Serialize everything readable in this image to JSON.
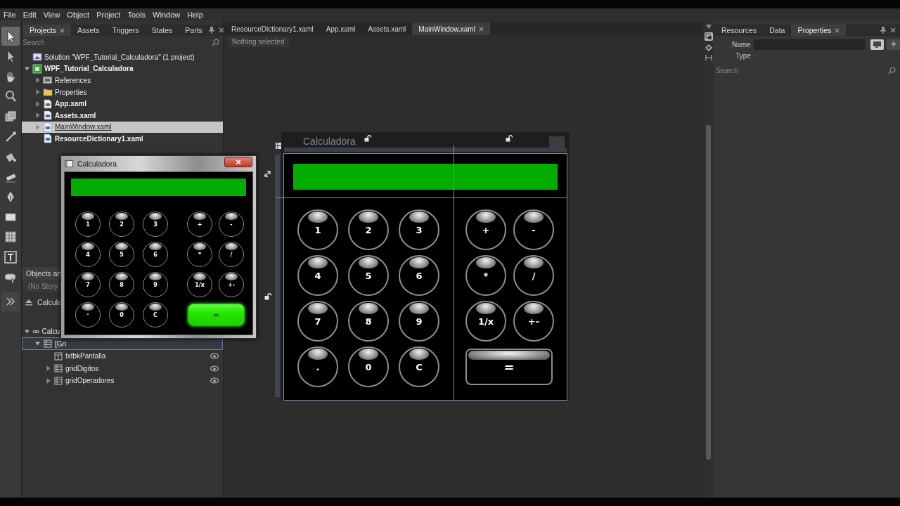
{
  "menu": [
    "File",
    "Edit",
    "View",
    "Object",
    "Project",
    "Tools",
    "Window",
    "Help"
  ],
  "tools": [
    {
      "kind": "select",
      "selected": true
    },
    {
      "kind": "direct-select",
      "selected": false
    },
    {
      "kind": "pan",
      "selected": false
    },
    {
      "kind": "zoom",
      "selected": false
    },
    {
      "kind": "camera",
      "selected": false
    },
    {
      "kind": "eyedropper",
      "selected": false
    },
    {
      "kind": "bucket",
      "selected": false
    },
    {
      "kind": "brush",
      "selected": false
    },
    {
      "kind": "pen",
      "selected": false
    },
    {
      "kind": "rectangle",
      "selected": false
    },
    {
      "kind": "grid",
      "selected": false
    },
    {
      "kind": "text",
      "selected": false
    },
    {
      "kind": "control",
      "selected": false
    }
  ],
  "projects_panel": {
    "tabs": [
      {
        "label": "Projects",
        "selected": true,
        "closable": true
      },
      {
        "label": "Assets",
        "selected": false,
        "closable": false
      },
      {
        "label": "Triggers",
        "selected": false,
        "closable": false
      },
      {
        "label": "States",
        "selected": false,
        "closable": false
      },
      {
        "label": "Parts",
        "selected": false,
        "closable": false
      }
    ],
    "search": {
      "placeholder": "Search"
    },
    "tree": [
      {
        "label": "Solution \"WPF_Tutorial_Calculadora\" (1 project)",
        "kind": "solution",
        "bold": false,
        "selected": false
      },
      {
        "label": "WPF_Tutorial_Calculadora",
        "kind": "project",
        "bold": true,
        "selected": false,
        "expanded": true,
        "children": [
          {
            "label": "References",
            "kind": "references",
            "bold": false,
            "selected": false,
            "expanded": false
          },
          {
            "label": "Properties",
            "kind": "folder",
            "bold": false,
            "selected": false,
            "expanded": false
          },
          {
            "label": "App.xaml",
            "kind": "xaml",
            "bold": true,
            "selected": false,
            "expanded": false
          },
          {
            "label": "Assets.xaml",
            "kind": "xaml",
            "bold": true,
            "selected": false,
            "expanded": false
          },
          {
            "label": "MainWindow.xaml",
            "kind": "xaml",
            "bold": false,
            "selected": true,
            "expanded": false
          },
          {
            "label": "ResourceDictionary1.xaml",
            "kind": "xaml",
            "bold": true,
            "selected": false
          }
        ]
      }
    ]
  },
  "objects_panel": {
    "title": "Objects an",
    "storyboard": "(No Story",
    "scope": "Calcula",
    "tree": [
      {
        "label": "Calcu",
        "kind": "window",
        "selected": false,
        "expanded": true,
        "children": [
          {
            "label": "[Gri",
            "kind": "grid",
            "selected": true,
            "expanded": true,
            "children": [
              {
                "label": "txtbkPantalla",
                "kind": "textblock",
                "selected": false,
                "visible": true
              },
              {
                "label": "gridDigitos",
                "kind": "grid",
                "selected": false,
                "expanded": false,
                "visible": true
              },
              {
                "label": "gridOperadores",
                "kind": "grid",
                "selected": false,
                "expanded": false,
                "visible": true
              }
            ]
          }
        ]
      }
    ]
  },
  "document": {
    "tabs": [
      {
        "label": "ResourceDictionary1.xaml",
        "selected": false,
        "closable": false
      },
      {
        "label": "App.xaml",
        "selected": false,
        "closable": false
      },
      {
        "label": "Assets.xaml",
        "selected": false,
        "closable": false
      },
      {
        "label": "MainWindow.xaml",
        "selected": true,
        "closable": true
      }
    ],
    "breadcrumb": "Nothing selected"
  },
  "artboard": {
    "title": "Calculadora",
    "digits": [
      "1",
      "2",
      "3",
      "4",
      "5",
      "6",
      "7",
      "8",
      "9",
      ".",
      "0",
      "C"
    ],
    "operators": [
      "+",
      "-",
      "*",
      "/",
      "1/x",
      "+-"
    ],
    "equals": {
      "label": "=",
      "highlighted": false
    }
  },
  "app_window": {
    "title": "Calculadora",
    "digits": [
      "1",
      "2",
      "3",
      "4",
      "5",
      "6",
      "7",
      "8",
      "9",
      ".",
      "0",
      "C"
    ],
    "operators": [
      "+",
      "-",
      "*",
      "/",
      "1/x",
      "+-"
    ],
    "equals": {
      "label": "=",
      "highlighted": true
    }
  },
  "properties_panel": {
    "tabs": [
      {
        "label": "Resources",
        "selected": false,
        "closable": false
      },
      {
        "label": "Data",
        "selected": false,
        "closable": false
      },
      {
        "label": "Properties",
        "selected": true,
        "closable": true
      }
    ],
    "name_label": "Name",
    "type_label": "Type",
    "search": {
      "placeholder": "Search"
    }
  }
}
